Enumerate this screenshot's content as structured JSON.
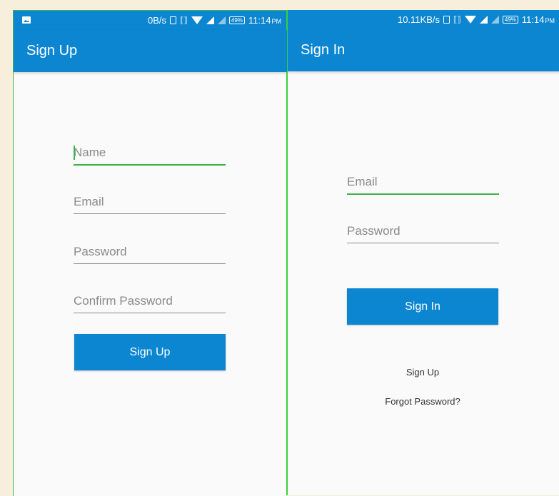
{
  "colors": {
    "primary": "#0d86d2",
    "focus": "#3bb54a"
  },
  "left": {
    "status": {
      "speed": "0B/s",
      "battery": "49%",
      "time": "11:14",
      "ampm": "PM"
    },
    "appbar_title": "Sign Up",
    "fields": [
      {
        "placeholder": "Name"
      },
      {
        "placeholder": "Email"
      },
      {
        "placeholder": "Password"
      },
      {
        "placeholder": "Confirm Password"
      }
    ],
    "button_label": "Sign Up"
  },
  "right": {
    "status": {
      "speed": "10.11KB/s",
      "battery": "49%",
      "time": "11:14",
      "ampm": "PM"
    },
    "appbar_title": "Sign In",
    "fields": [
      {
        "placeholder": "Email"
      },
      {
        "placeholder": "Password"
      }
    ],
    "button_label": "Sign In",
    "links": {
      "sign_up": "Sign Up",
      "forgot_password": "Forgot Password?"
    }
  }
}
